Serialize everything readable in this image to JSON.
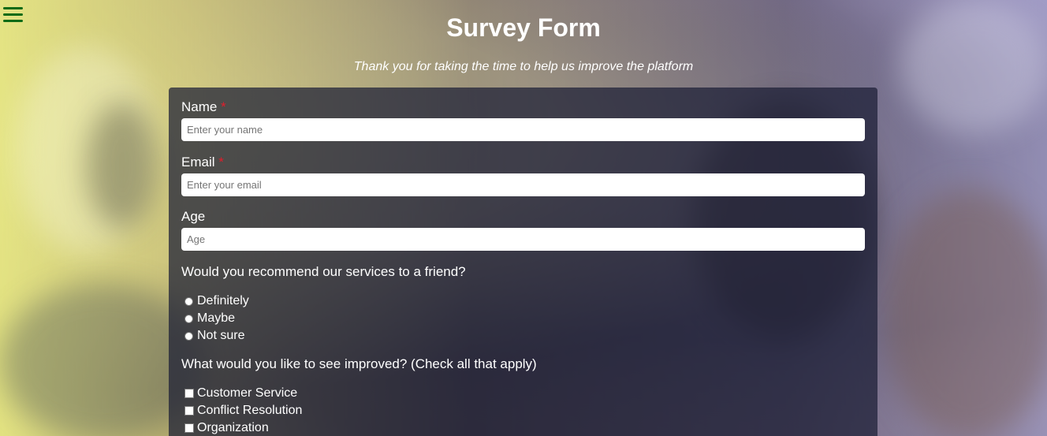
{
  "header": {
    "title": "Survey Form",
    "subtitle": "Thank you for taking the time to help us improve the platform"
  },
  "form": {
    "name": {
      "label": "Name",
      "required_mark": "*",
      "placeholder": "Enter your name"
    },
    "email": {
      "label": "Email",
      "required_mark": "*",
      "placeholder": "Enter your email"
    },
    "age": {
      "label": "Age",
      "placeholder": "Age"
    },
    "recommend": {
      "question": "Would you recommend our services to a friend?",
      "options": [
        "Definitely",
        "Maybe",
        "Not sure"
      ]
    },
    "improve": {
      "question": "What would you like to see improved? (Check all that apply)",
      "options": [
        "Customer Service",
        "Conflict Resolution",
        "Organization"
      ]
    }
  },
  "colors": {
    "menu_icon": "#0b6a16",
    "required": "#e11d2b",
    "form_background": "#1b1d34"
  },
  "icons": {
    "menu": "hamburger-menu-icon"
  }
}
